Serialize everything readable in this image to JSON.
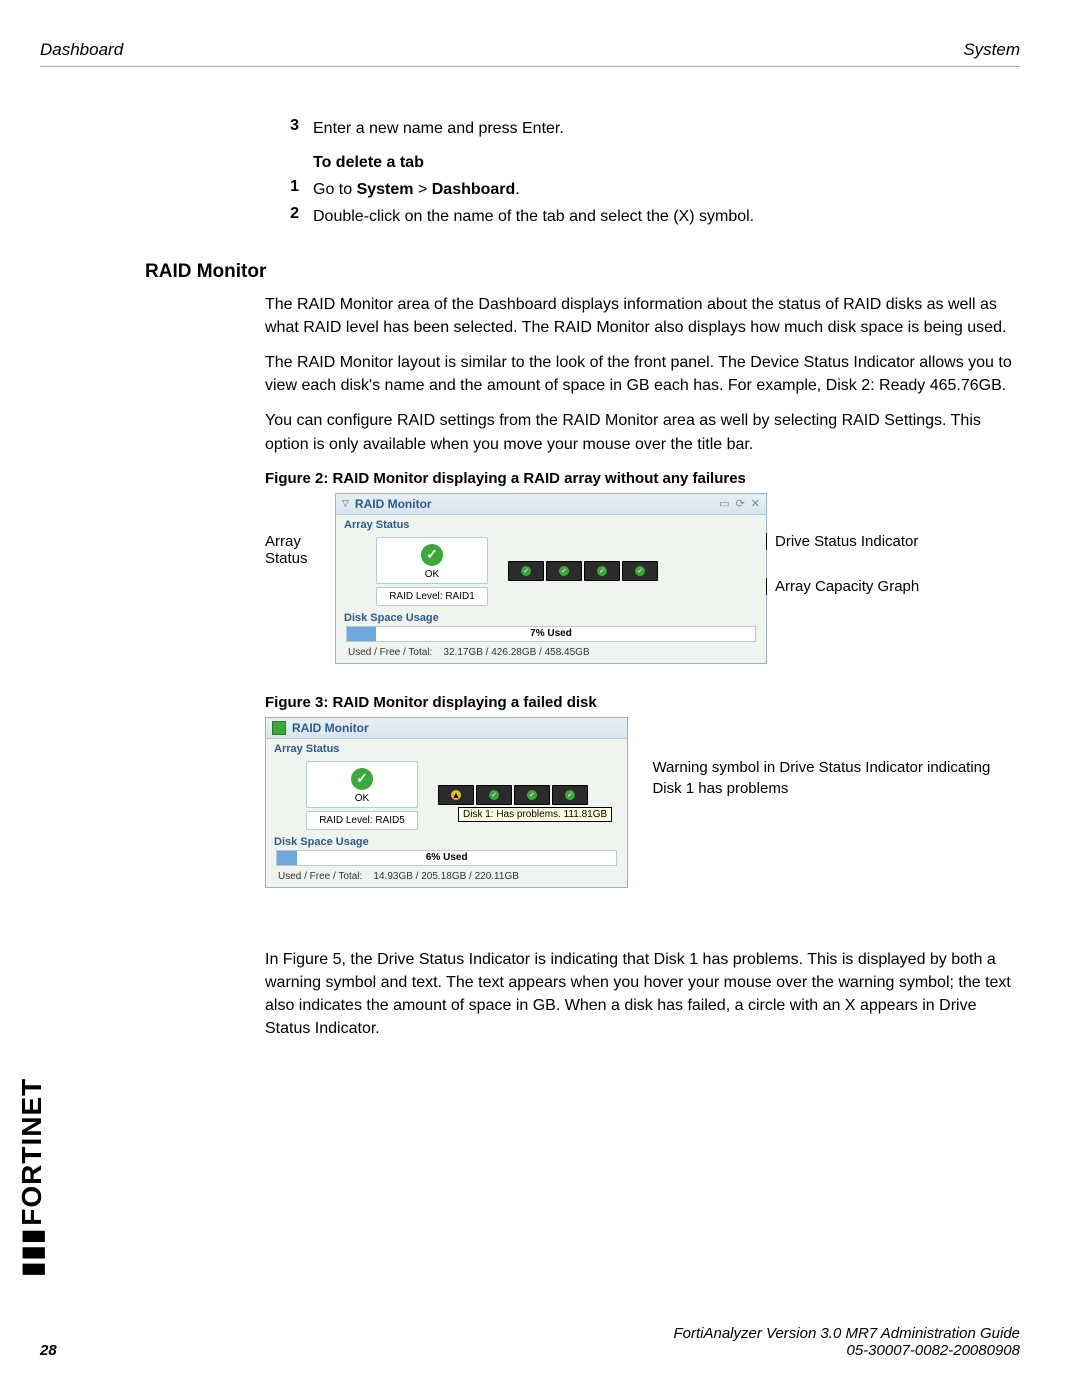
{
  "header": {
    "left": "Dashboard",
    "right": "System"
  },
  "steps_top": {
    "s3": "Enter a new name and press Enter."
  },
  "delete_tab": {
    "heading": "To delete a tab",
    "s1_pre": "Go to ",
    "s1_b1": "System",
    "s1_mid": " > ",
    "s1_b2": "Dashboard",
    "s1_post": ".",
    "s2": "Double-click on the name of the tab and select the (X) symbol."
  },
  "section_title": "RAID Monitor",
  "p1": "The RAID Monitor area of the Dashboard displays information about the status of RAID disks as well as what RAID level has been selected. The RAID Monitor also displays how much disk space is being used.",
  "p2": "The RAID Monitor layout is similar to the look of the front panel. The Device Status Indicator allows you to view each disk's name and the amount of space in GB each has. For example, Disk 2: Ready 465.76GB.",
  "p3": "You can configure RAID settings from the RAID Monitor area as well by selecting RAID Settings. This option is only available when you move your mouse over the title bar.",
  "fig2": {
    "caption": "Figure 2:  RAID Monitor displaying a RAID array without any failures",
    "callout_left": "Array Status",
    "callout_r1": "Drive Status Indicator",
    "callout_r2": "Array Capacity Graph",
    "widget_title": "RAID Monitor",
    "array_status_label": "Array Status",
    "ok_label": "OK",
    "raid_level": "RAID Level: RAID1",
    "disk_usage_label": "Disk Space Usage",
    "used_pct": "7% Used",
    "totals_label": "Used / Free / Total:",
    "totals_values": "32.17GB / 426.28GB / 458.45GB"
  },
  "fig3": {
    "caption": "Figure 3:  RAID Monitor displaying a failed disk",
    "callout_right": "Warning symbol in Drive Status Indicator indicating Disk 1 has problems",
    "widget_title": "RAID Monitor",
    "array_status_label": "Array Status",
    "ok_label": "OK",
    "raid_level": "RAID Level: RAID5",
    "tooltip": "Disk 1: Has problems. 111.81GB",
    "disk_usage_label": "Disk Space Usage",
    "used_pct": "6% Used",
    "totals_label": "Used / Free / Total:",
    "totals_values": "14.93GB / 205.18GB / 220.11GB"
  },
  "p4": "In Figure 5, the Drive Status Indicator is indicating that Disk 1 has problems. This is displayed by both a warning symbol and text. The text appears when you hover your mouse over the warning symbol; the text also indicates the amount of space in GB. When a disk has failed, a circle with an X appears in Drive Status Indicator.",
  "footer": {
    "page": "28",
    "line1": "FortiAnalyzer Version 3.0 MR7 Administration Guide",
    "line2": "05-30007-0082-20080908"
  },
  "brand": "FORTINET"
}
